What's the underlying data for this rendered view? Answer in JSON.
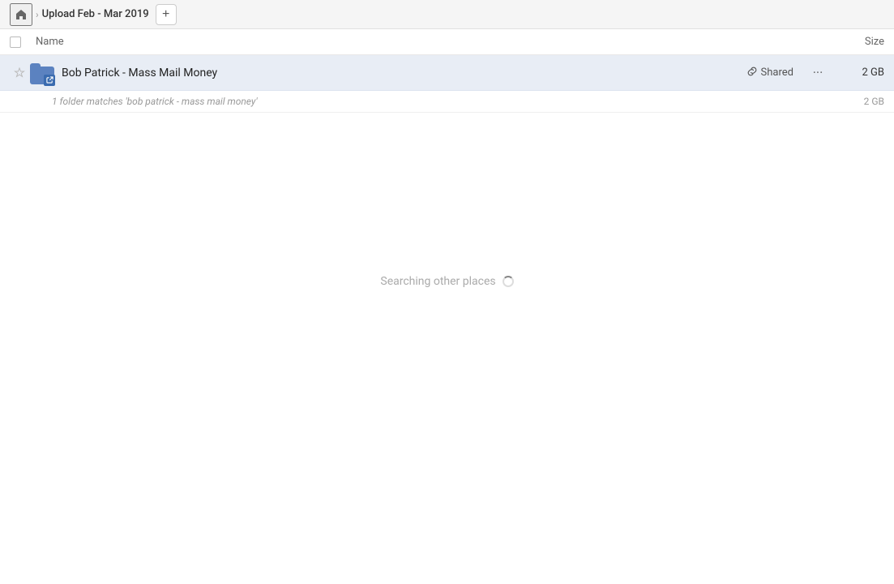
{
  "header": {
    "home_icon": "🏠",
    "chevron": "›",
    "breadcrumb_title": "Upload Feb - Mar 2019",
    "add_button_label": "+"
  },
  "columns": {
    "name_label": "Name",
    "size_label": "Size"
  },
  "file_row": {
    "file_name": "Bob Patrick - Mass Mail Money",
    "shared_label": "Shared",
    "size": "2 GB",
    "more_icon": "···"
  },
  "match_info": {
    "text": "1 folder matches 'bob patrick - mass mail money'",
    "size": "2 GB"
  },
  "searching": {
    "text": "Searching other places"
  }
}
